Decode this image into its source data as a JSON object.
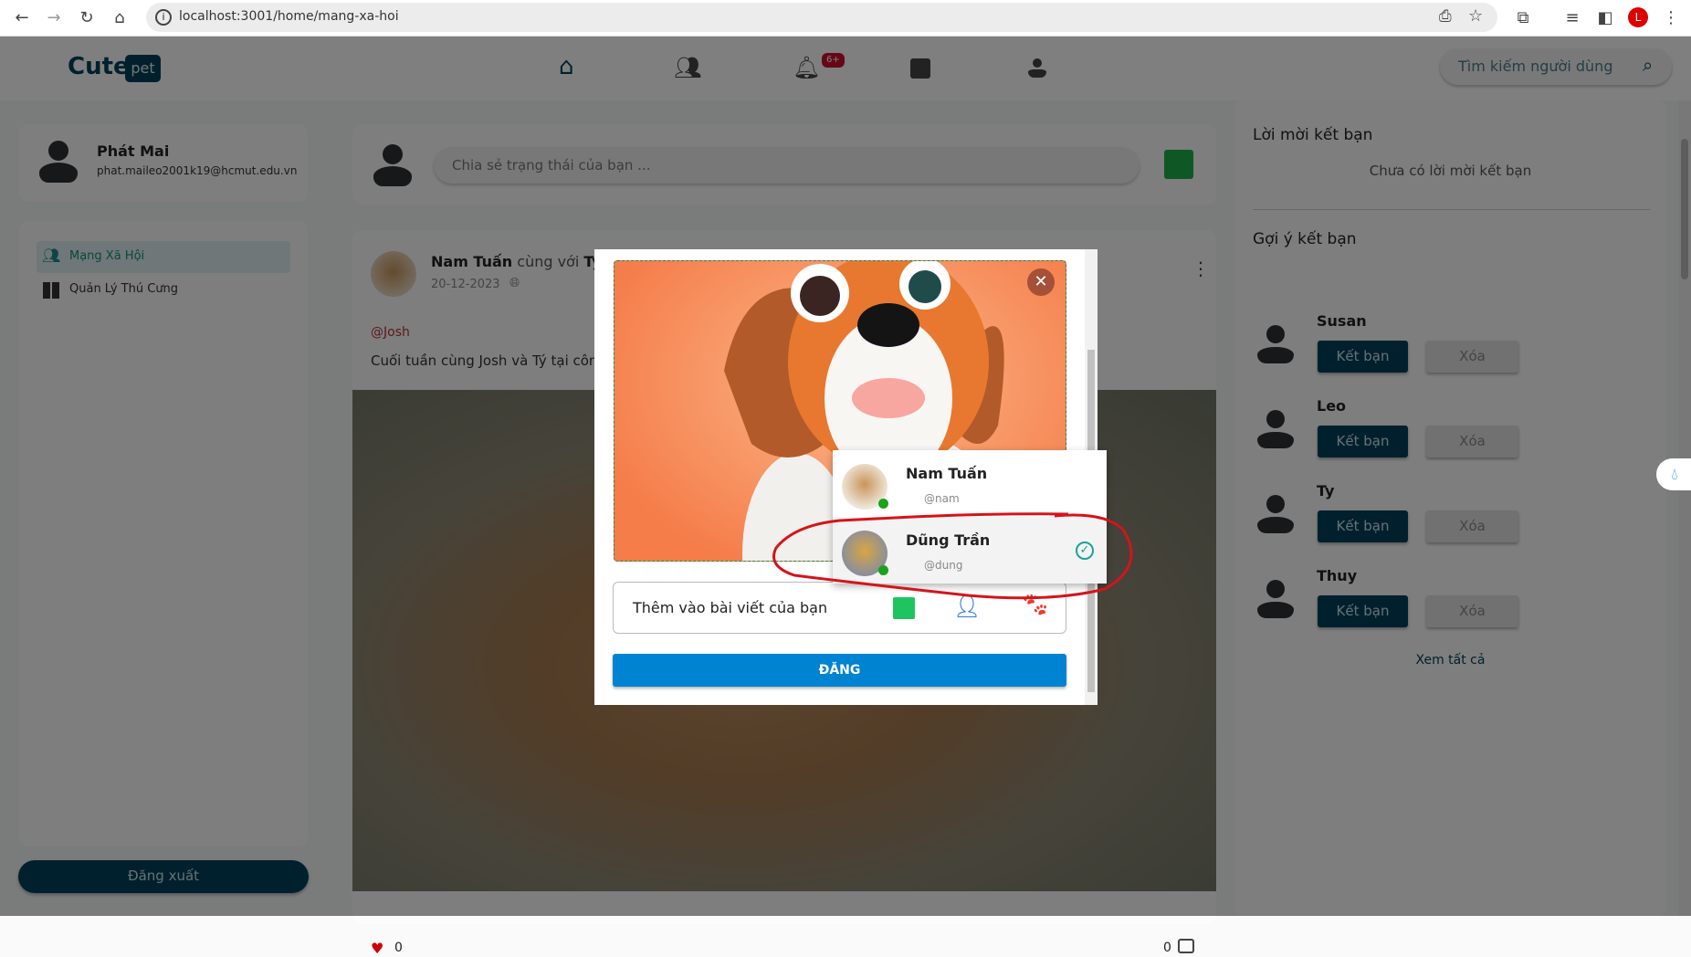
{
  "browser": {
    "url": "localhost:3001/home/mang-xa-hoi",
    "profile_initial": "L"
  },
  "header": {
    "logo_text": "Cute",
    "logo_badge": "pet",
    "nav": [
      "home-icon",
      "friends-icon",
      "bell-icon",
      "newsfeed-icon",
      "profile-icon"
    ],
    "notification_badge": "6+",
    "search_placeholder": "Tìm kiếm người dùng"
  },
  "user": {
    "name": "Phát Mai",
    "email": "phat.maileo2001k19@hcmut.edu.vn"
  },
  "sidebar": {
    "items": [
      {
        "label": "Mạng Xã Hội",
        "active": true
      },
      {
        "label": "Quản Lý Thú Cưng",
        "active": false
      }
    ],
    "logout": "Đăng xuất"
  },
  "composer": {
    "placeholder": "Chia sẻ trạng thái của bạn ..."
  },
  "post": {
    "author": "Nam Tuấn",
    "with_text": "cùng với",
    "tagged": "Ty",
    "date": "20-12-2023",
    "mention": "@Josh",
    "text": "Cuối tuần cùng Josh và Tý tại công",
    "likes": "0",
    "comments": "0"
  },
  "right": {
    "requests_title": "Lời mời kết bạn",
    "requests_empty": "Chưa có lời mời kết bạn",
    "suggest_title": "Gợi ý kết bạn",
    "suggestions": [
      {
        "name": "Susan"
      },
      {
        "name": "Leo"
      },
      {
        "name": "Ty"
      },
      {
        "name": "Thuy"
      }
    ],
    "add_label": "Kết bạn",
    "remove_label": "Xóa",
    "see_all": "Xem tất cả"
  },
  "modal": {
    "add_to_post": "Thêm vào bài viết của bạn",
    "post_button": "ĐĂNG",
    "tag_options": [
      {
        "name": "Nam Tuấn",
        "handle": "@nam",
        "selected": false,
        "online": true
      },
      {
        "name": "Dũng Trần",
        "handle": "@dung",
        "selected": true,
        "online": true
      }
    ]
  },
  "colors": {
    "brand": "#00415a",
    "primary_button": "#0083d1",
    "badge": "#c8102e",
    "online": "#1aa31a",
    "check": "#1aa39a"
  }
}
